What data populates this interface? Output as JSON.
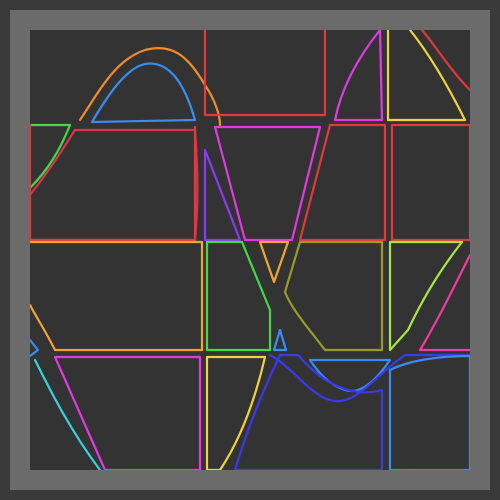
{
  "scene": {
    "background": "#333333",
    "frame_color": "#6b6b6b",
    "page_color": "#3a3a3a"
  },
  "palette": {
    "red": "#e03a3a",
    "crimson": "#d8344e",
    "orange": "#ef8c2c",
    "amber": "#f2a532",
    "yellow": "#f0d23a",
    "olive": "#9a9a28",
    "green": "#44d844",
    "lime": "#a6e83a",
    "cyan": "#3ad0e0",
    "blue": "#3a8cf0",
    "indigo": "#3a3ae8",
    "violet": "#8a3af0",
    "magenta": "#e03ae0",
    "pink": "#f03aa0"
  }
}
